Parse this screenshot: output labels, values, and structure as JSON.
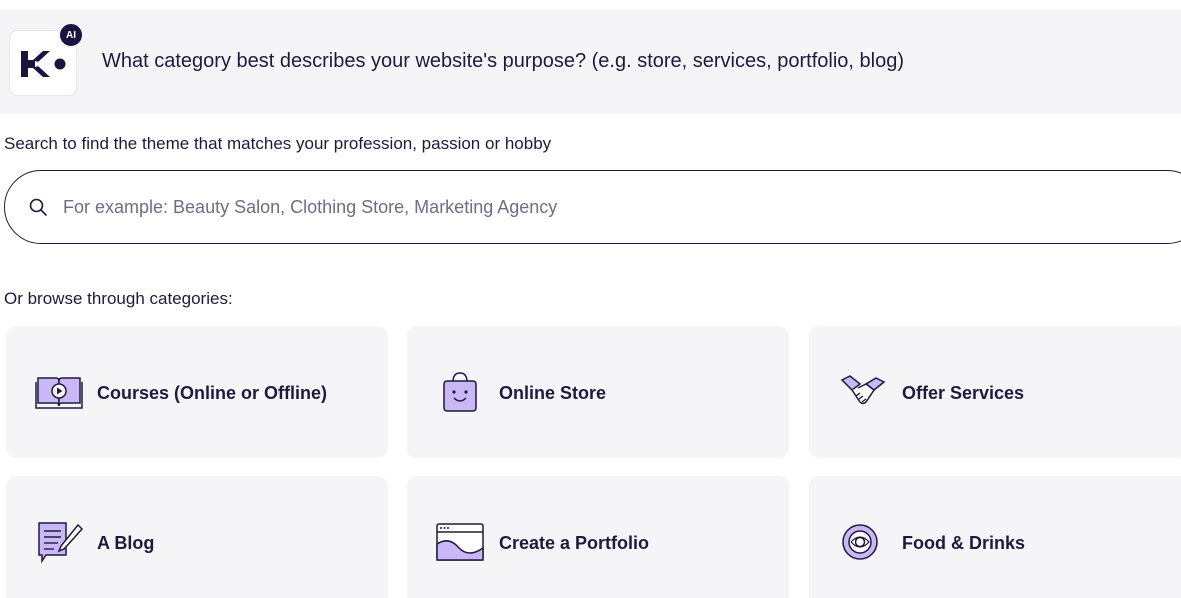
{
  "assistant": {
    "badge": "AI",
    "question": "What category best describes your website's purpose? (e.g. store, services, portfolio, blog)"
  },
  "search": {
    "hint": "Search to find the theme that matches your profession, passion or hobby",
    "placeholder": "For example: Beauty Salon, Clothing Store, Marketing Agency",
    "icon": "search-icon"
  },
  "browse": {
    "label": "Or browse through categories:"
  },
  "categories": [
    {
      "label": "Courses (Online or Offline)",
      "icon": "open-book-play-icon"
    },
    {
      "label": "Online Store",
      "icon": "shopping-bag-icon"
    },
    {
      "label": "Offer Services",
      "icon": "handshake-icon"
    },
    {
      "label": "A Blog",
      "icon": "notepad-pencil-icon"
    },
    {
      "label": "Create a Portfolio",
      "icon": "browser-landscape-icon"
    },
    {
      "label": "Food & Drinks",
      "icon": "plate-icon"
    }
  ],
  "colors": {
    "accent": "#c9b8f5",
    "ink": "#1f1a3d",
    "card_bg": "#f5f5f8"
  }
}
